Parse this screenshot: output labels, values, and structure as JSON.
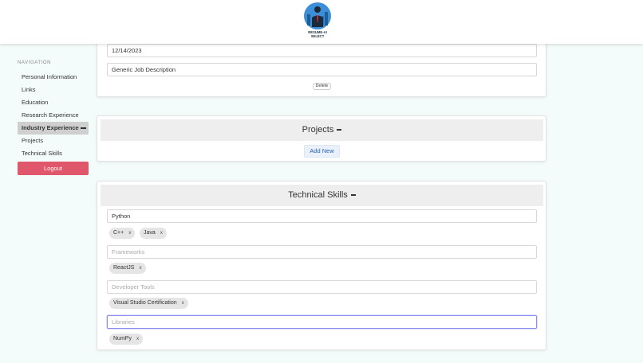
{
  "logo": {
    "text": "RESUME-AI SELECT",
    "icon": "businessman-city-logo"
  },
  "sidebar": {
    "heading": "NAVIGATION",
    "items": [
      {
        "label": "Personal Information"
      },
      {
        "label": "Links"
      },
      {
        "label": "Education"
      },
      {
        "label": "Research Experience"
      },
      {
        "label": "Industry Experience"
      },
      {
        "label": "Projects"
      },
      {
        "label": "Technical Skills"
      }
    ],
    "active_index": 4,
    "logout_label": "Logout"
  },
  "industry": {
    "date_value": "12/14/2023",
    "description_value": "Generic Job Description",
    "delete_label": "Delete"
  },
  "projects": {
    "title": "Projects",
    "add_label": "Add New"
  },
  "skills": {
    "title": "Technical Skills",
    "languages_value": "Python",
    "language_tags": [
      {
        "label": "C++"
      },
      {
        "label": "Java"
      }
    ],
    "frameworks_placeholder": "Frameworks",
    "framework_tags": [
      {
        "label": "ReactJS"
      }
    ],
    "tools_placeholder": "Developer Tools",
    "tool_tags": [
      {
        "label": "Visual Studio Certification"
      }
    ],
    "libraries_placeholder": "Libraries",
    "library_tags": [
      {
        "label": "NumPy"
      }
    ],
    "remove_symbol": "x"
  },
  "colors": {
    "logout": "#e0566a",
    "accent_blue": "#2b5fb0",
    "page_bg": "#f4fbfb"
  }
}
